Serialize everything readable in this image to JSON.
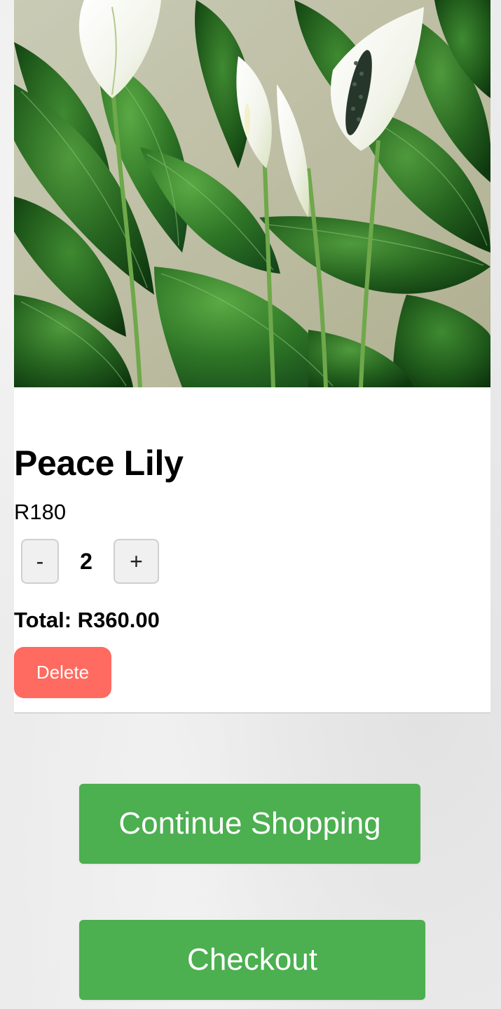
{
  "product": {
    "name": "Peace Lily",
    "price": "R180",
    "image": "peace-lily-photo"
  },
  "quantity": {
    "decrement_label": "-",
    "value": "2",
    "increment_label": "+"
  },
  "total": {
    "text": "Total: R360.00"
  },
  "actions": {
    "delete_label": "Delete",
    "continue_label": "Continue Shopping",
    "checkout_label": "Checkout"
  },
  "colors": {
    "primary_green": "#4caf50",
    "delete_red": "#ff6a61"
  }
}
